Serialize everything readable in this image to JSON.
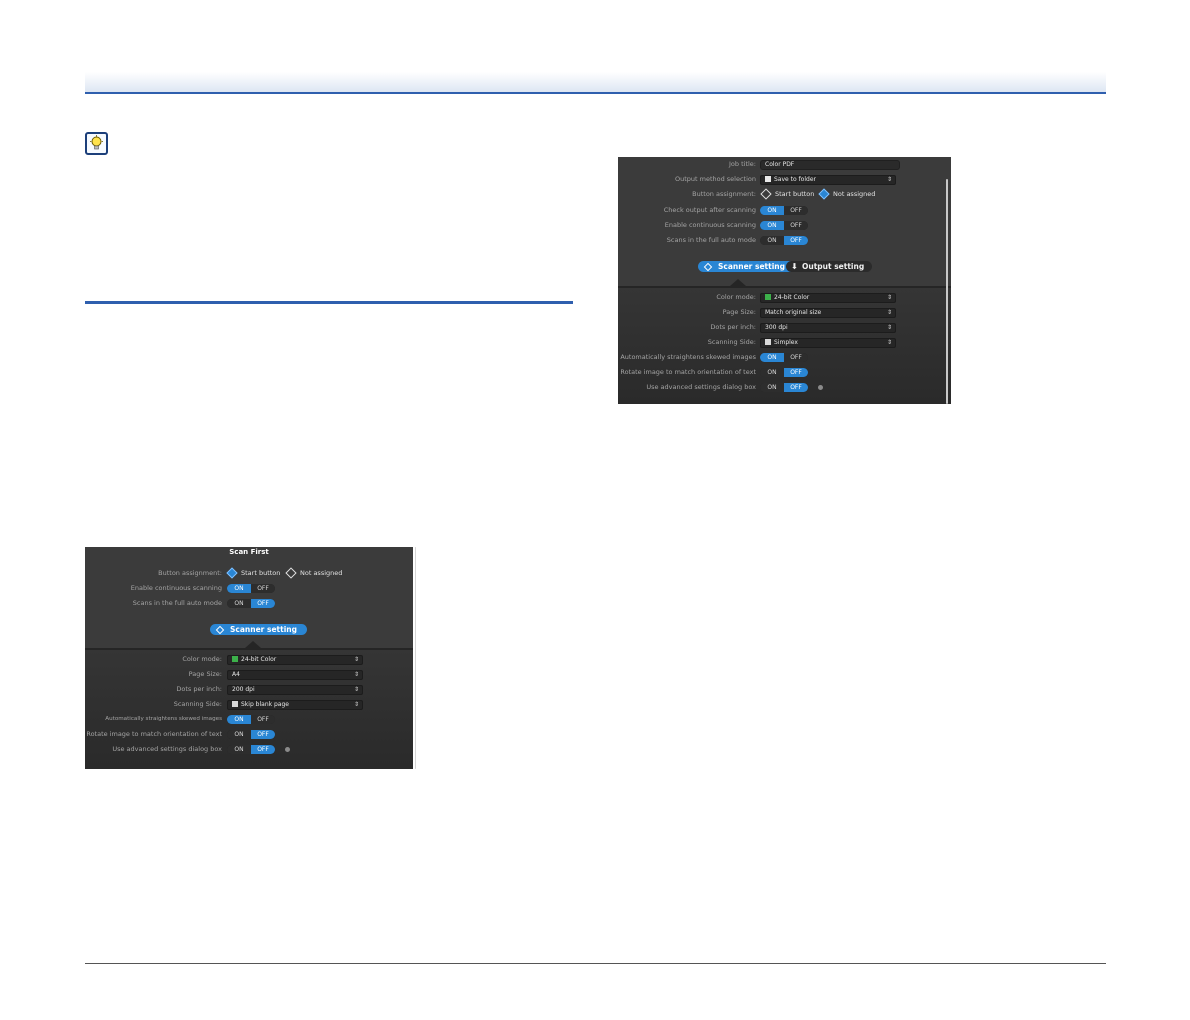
{
  "panel_left": {
    "title": "Scan First",
    "button_assignment": {
      "label": "Button assignment:",
      "option1": "Start button",
      "option2": "Not assigned"
    },
    "enable_continuous": {
      "label": "Enable continuous scanning",
      "on": "ON",
      "off": "OFF",
      "state": "on"
    },
    "full_auto": {
      "label": "Scans in the full auto mode",
      "on": "ON",
      "off": "OFF",
      "state": "off"
    },
    "scanner_setting_button": "Scanner setting",
    "color_mode": {
      "label": "Color mode:",
      "value": "24-bit Color"
    },
    "page_size": {
      "label": "Page Size:",
      "value": "A4"
    },
    "dpi": {
      "label": "Dots per inch:",
      "value": "200 dpi"
    },
    "scanning_side": {
      "label": "Scanning Side:",
      "value": "Skip blank page"
    },
    "straighten": {
      "label": "Automatically straightens skewed images",
      "on": "ON",
      "off": "OFF",
      "state": "on"
    },
    "rotate": {
      "label": "Rotate image to match orientation of text",
      "on": "ON",
      "off": "OFF",
      "state": "off"
    },
    "advanced": {
      "label": "Use advanced settings dialog box",
      "on": "ON",
      "off": "OFF",
      "state": "off"
    }
  },
  "panel_right": {
    "job_title": {
      "label": "Job title:",
      "value": "Color PDF"
    },
    "output_method": {
      "label": "Output method selection",
      "value": "Save to folder"
    },
    "button_assignment": {
      "label": "Button assignment:",
      "option1": "Start button",
      "option2": "Not assigned"
    },
    "check_output": {
      "label": "Check output after scanning",
      "on": "ON",
      "off": "OFF",
      "state": "on"
    },
    "enable_continuous": {
      "label": "Enable continuous scanning",
      "on": "ON",
      "off": "OFF",
      "state": "on"
    },
    "full_auto": {
      "label": "Scans in the full auto mode",
      "on": "ON",
      "off": "OFF",
      "state": "off"
    },
    "scanner_setting_button": "Scanner setting",
    "output_setting_button": "Output setting",
    "color_mode": {
      "label": "Color mode:",
      "value": "24-bit Color"
    },
    "page_size": {
      "label": "Page Size:",
      "value": "Match original size"
    },
    "dpi": {
      "label": "Dots per inch:",
      "value": "300 dpi"
    },
    "scanning_side": {
      "label": "Scanning Side:",
      "value": "Simplex"
    },
    "straighten": {
      "label": "Automatically straightens skewed images",
      "on": "ON",
      "off": "OFF",
      "state": "on"
    },
    "rotate": {
      "label": "Rotate image to match orientation of text",
      "on": "ON",
      "off": "OFF",
      "state": "off"
    },
    "advanced": {
      "label": "Use advanced settings dialog box",
      "on": "ON",
      "off": "OFF",
      "state": "off"
    }
  },
  "colors": {
    "accent": "#2a86d4",
    "rule": "#2f5fae",
    "panel_bg": "#3b3b3b"
  }
}
